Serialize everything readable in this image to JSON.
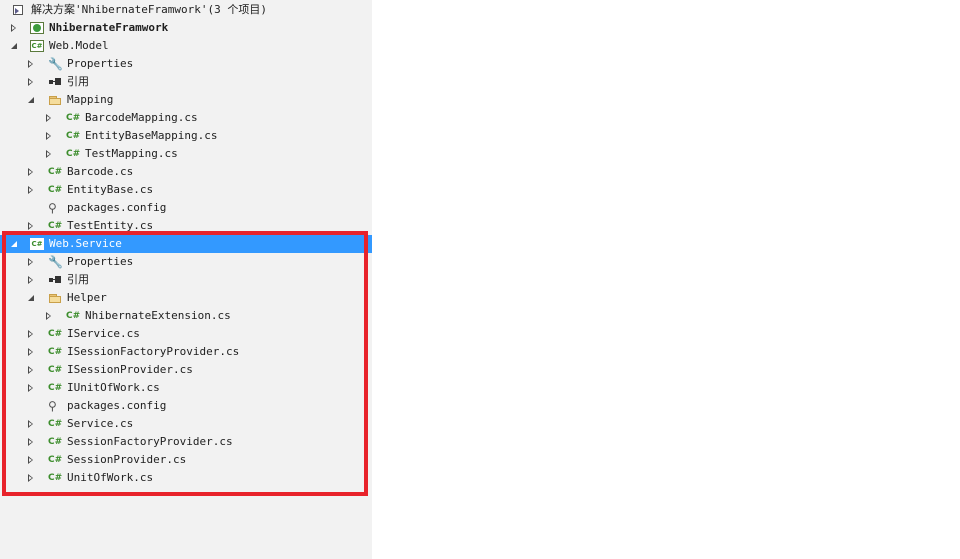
{
  "solution_explorer": {
    "items": [
      {
        "label": "解决方案'NhibernateFramwork'(3 个项目)",
        "icon": "solution-icon",
        "indent": 0,
        "arrow": "none",
        "bold": false,
        "selected": false
      },
      {
        "label": "NhibernateFramwork",
        "icon": "web-project-icon",
        "indent": 0,
        "arrow": "collapsed",
        "bold": true,
        "selected": false
      },
      {
        "label": "Web.Model",
        "icon": "csharp-project-icon",
        "indent": 0,
        "arrow": "expanded",
        "bold": false,
        "selected": false
      },
      {
        "label": "Properties",
        "icon": "wrench-icon",
        "indent": 1,
        "arrow": "collapsed",
        "bold": false,
        "selected": false
      },
      {
        "label": "引用",
        "icon": "references-icon",
        "indent": 1,
        "arrow": "collapsed",
        "bold": false,
        "selected": false
      },
      {
        "label": "Mapping",
        "icon": "folder-icon",
        "indent": 1,
        "arrow": "expanded",
        "bold": false,
        "selected": false
      },
      {
        "label": "BarcodeMapping.cs",
        "icon": "csharp-file-icon",
        "indent": 2,
        "arrow": "collapsed",
        "bold": false,
        "selected": false
      },
      {
        "label": "EntityBaseMapping.cs",
        "icon": "csharp-file-icon",
        "indent": 2,
        "arrow": "collapsed",
        "bold": false,
        "selected": false
      },
      {
        "label": "TestMapping.cs",
        "icon": "csharp-file-icon",
        "indent": 2,
        "arrow": "collapsed",
        "bold": false,
        "selected": false
      },
      {
        "label": "Barcode.cs",
        "icon": "csharp-file-icon",
        "indent": 1,
        "arrow": "collapsed",
        "bold": false,
        "selected": false
      },
      {
        "label": "EntityBase.cs",
        "icon": "csharp-file-icon",
        "indent": 1,
        "arrow": "collapsed",
        "bold": false,
        "selected": false
      },
      {
        "label": "packages.config",
        "icon": "config-file-icon",
        "indent": 1,
        "arrow": "none",
        "bold": false,
        "selected": false
      },
      {
        "label": "TestEntity.cs",
        "icon": "csharp-file-icon",
        "indent": 1,
        "arrow": "collapsed",
        "bold": false,
        "selected": false
      },
      {
        "label": "Web.Service",
        "icon": "csharp-project-icon",
        "indent": 0,
        "arrow": "expanded",
        "bold": false,
        "selected": true
      },
      {
        "label": "Properties",
        "icon": "wrench-icon",
        "indent": 1,
        "arrow": "collapsed",
        "bold": false,
        "selected": false
      },
      {
        "label": "引用",
        "icon": "references-icon",
        "indent": 1,
        "arrow": "collapsed",
        "bold": false,
        "selected": false
      },
      {
        "label": "Helper",
        "icon": "folder-icon",
        "indent": 1,
        "arrow": "expanded",
        "bold": false,
        "selected": false
      },
      {
        "label": "NhibernateExtension.cs",
        "icon": "csharp-file-icon",
        "indent": 2,
        "arrow": "collapsed",
        "bold": false,
        "selected": false
      },
      {
        "label": "IService.cs",
        "icon": "csharp-file-icon",
        "indent": 1,
        "arrow": "collapsed",
        "bold": false,
        "selected": false
      },
      {
        "label": "ISessionFactoryProvider.cs",
        "icon": "csharp-file-icon",
        "indent": 1,
        "arrow": "collapsed",
        "bold": false,
        "selected": false
      },
      {
        "label": "ISessionProvider.cs",
        "icon": "csharp-file-icon",
        "indent": 1,
        "arrow": "collapsed",
        "bold": false,
        "selected": false
      },
      {
        "label": "IUnitOfWork.cs",
        "icon": "csharp-file-icon",
        "indent": 1,
        "arrow": "collapsed",
        "bold": false,
        "selected": false
      },
      {
        "label": "packages.config",
        "icon": "config-file-icon",
        "indent": 1,
        "arrow": "none",
        "bold": false,
        "selected": false
      },
      {
        "label": "Service.cs",
        "icon": "csharp-file-icon",
        "indent": 1,
        "arrow": "collapsed",
        "bold": false,
        "selected": false
      },
      {
        "label": "SessionFactoryProvider.cs",
        "icon": "csharp-file-icon",
        "indent": 1,
        "arrow": "collapsed",
        "bold": false,
        "selected": false
      },
      {
        "label": "SessionProvider.cs",
        "icon": "csharp-file-icon",
        "indent": 1,
        "arrow": "collapsed",
        "bold": false,
        "selected": false
      },
      {
        "label": "UnitOfWork.cs",
        "icon": "csharp-file-icon",
        "indent": 1,
        "arrow": "collapsed",
        "bold": false,
        "selected": false
      }
    ]
  },
  "icons": {
    "csharp_glyph": "C#",
    "wrench_glyph": "🔧",
    "config_glyph": "⚲"
  },
  "colors": {
    "panel_background": "#f2f2f2",
    "selection": "#3399ff",
    "highlight_box": "#e8232b",
    "csharp_green": "#3c8d2c"
  }
}
